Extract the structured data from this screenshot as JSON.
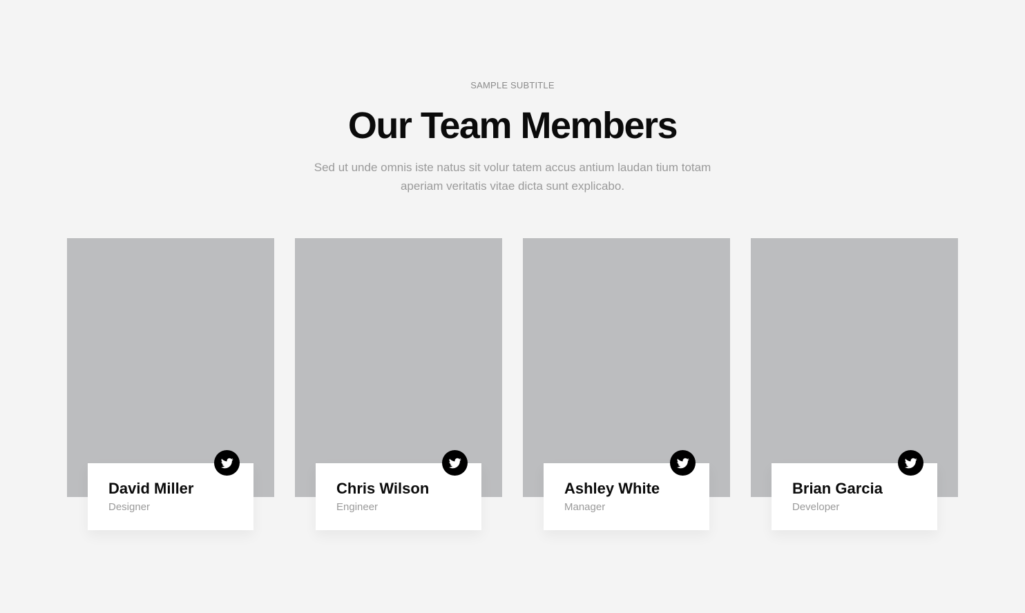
{
  "header": {
    "subtitle": "SAMPLE SUBTITLE",
    "title": "Our Team Members",
    "description": "Sed ut unde omnis iste natus sit volur tatem accus antium laudan tium totam aperiam veritatis vitae dicta sunt explicabo."
  },
  "team": [
    {
      "name": "David Miller",
      "role": "Designer",
      "social_icon": "twitter-icon"
    },
    {
      "name": "Chris Wilson",
      "role": "Engineer",
      "social_icon": "twitter-icon"
    },
    {
      "name": "Ashley White",
      "role": "Manager",
      "social_icon": "twitter-icon"
    },
    {
      "name": "Brian Garcia",
      "role": "Developer",
      "social_icon": "twitter-icon"
    }
  ],
  "colors": {
    "background": "#f4f4f4",
    "photo_placeholder": "#bcbdbf",
    "card": "#ffffff",
    "heading": "#0b0b0b",
    "muted_text": "#9a9a9a",
    "social_button": "#000000"
  }
}
